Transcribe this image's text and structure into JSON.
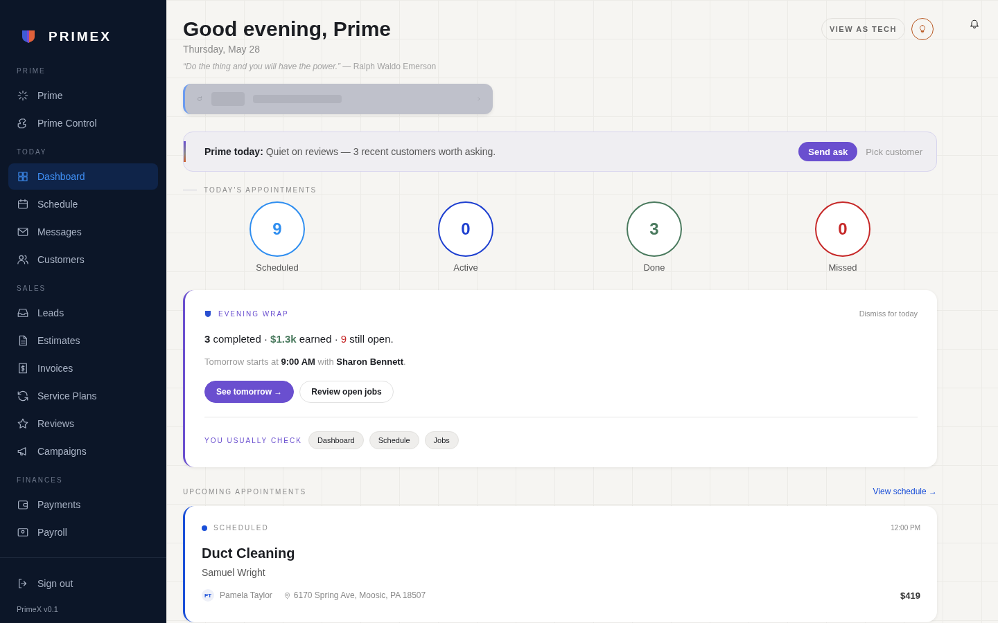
{
  "sidebar": {
    "brand": "PRIMEX",
    "sections": [
      {
        "title": "PRIME",
        "items": [
          {
            "label": "Prime",
            "selected": false
          },
          {
            "label": "Prime Control",
            "selected": false
          }
        ]
      },
      {
        "title": "TODAY",
        "items": [
          {
            "label": "Dashboard",
            "selected": true
          },
          {
            "label": "Schedule",
            "selected": false
          },
          {
            "label": "Messages",
            "selected": false
          },
          {
            "label": "Customers",
            "selected": false
          }
        ]
      },
      {
        "title": "SALES",
        "items": [
          {
            "label": "Leads",
            "selected": false
          },
          {
            "label": "Estimates",
            "selected": false
          },
          {
            "label": "Invoices",
            "selected": false
          },
          {
            "label": "Service Plans",
            "selected": false
          },
          {
            "label": "Reviews",
            "selected": false
          },
          {
            "label": "Campaigns",
            "selected": false
          }
        ]
      },
      {
        "title": "FINANCES",
        "items": [
          {
            "label": "Payments",
            "selected": false
          },
          {
            "label": "Payroll",
            "selected": false
          }
        ]
      }
    ],
    "footer": {
      "sign_out": "Sign out",
      "version": "PrimeX v0.1"
    }
  },
  "header": {
    "greeting": "Good evening, Prime",
    "date": "Thursday, May 28",
    "quote": "*“Do the thing and you will have the power.”* — Ralph Waldo Emerson",
    "view_as_button": "VIEW AS TECH"
  },
  "prime_today": {
    "text": "**Prime today:** Quiet on reviews — 3 recent customers worth asking.",
    "action": "Send ask",
    "secondary": "Pick customer"
  },
  "appointments": {
    "title": "TODAY'S APPOINTMENTS",
    "stats": [
      {
        "value": "9",
        "label": "Scheduled",
        "color": "#2f8ef0"
      },
      {
        "value": "0",
        "label": "Active",
        "color": "#1d3fd0"
      },
      {
        "value": "3",
        "label": "Done",
        "color": "#4a7a5e"
      },
      {
        "value": "0",
        "label": "Missed",
        "color": "#c62828"
      }
    ]
  },
  "evening_wrap": {
    "title": "EVENING WRAP",
    "dismiss": "Dismiss for today",
    "summary": [
      {
        "text": "3",
        "kind": "strong"
      },
      {
        "text": " completed · ",
        "kind": "plain"
      },
      {
        "text": "$1.3k",
        "kind": "money"
      },
      {
        "text": " earned · ",
        "kind": "plain"
      },
      {
        "text": "9",
        "kind": "alert"
      },
      {
        "text": " still open.",
        "kind": "plain"
      }
    ],
    "tomorrow": "Tomorrow starts at **9:00 AM** with **Sharon Bennett**.",
    "buttons": [
      {
        "label": "See tomorrow →",
        "kind": "primary"
      },
      {
        "label": "Review open jobs",
        "kind": "secondary"
      }
    ],
    "usual_label": "YOU USUALLY CHECK",
    "shortcuts": [
      "Dashboard",
      "Schedule",
      "Jobs"
    ]
  },
  "upcoming": {
    "title": "UPCOMING APPOINTMENTS",
    "link": "View schedule →",
    "items": [
      {
        "status": "SCHEDULED",
        "color": "#1a4fd8",
        "time": "12:00 PM",
        "service": "Duct Cleaning",
        "customer": "Samuel Wright",
        "tech_initials": "PT",
        "tech": "Pamela Taylor",
        "address": "6170 Spring Ave, Moosic, PA 18507",
        "price": "$419"
      }
    ]
  }
}
